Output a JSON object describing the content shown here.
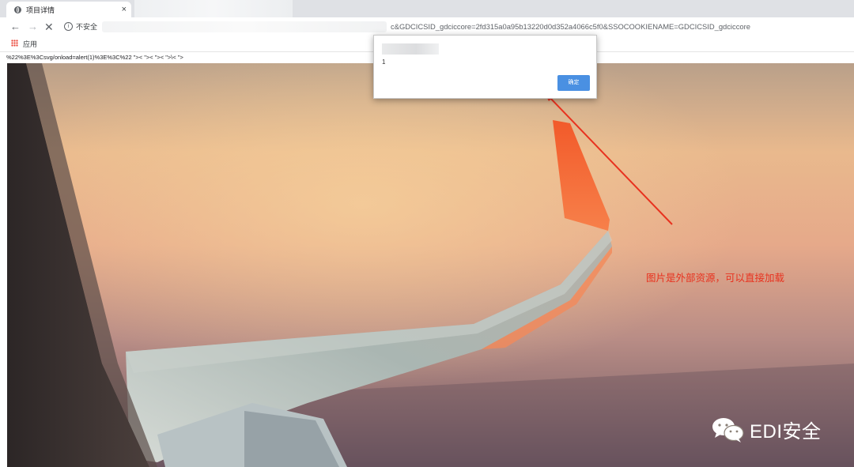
{
  "browser": {
    "tab_title": "项目详情",
    "tab_close": "×",
    "security_label": "不安全",
    "url_visible_text": "c&GDCICSID_gdciccore=2fd315a0a95b13220d0d352a4066c5f0&SSOCOOKIENAME=GDCICSID_gdciccore",
    "bookmark_apps_label": "应用",
    "nav_back": "←",
    "nav_forward": "→",
    "nav_stop": "✕",
    "info_glyph": "i"
  },
  "page": {
    "payload_text": "%22%3E%3Csvg/onload=alert(1)%3E%3C%22 \">< \">< \">< \">\\< \">"
  },
  "alert_dialog": {
    "message": "1",
    "ok_label": "确定"
  },
  "annotation": {
    "text": "图片是外部资源，可以直接加载",
    "color": "#e8321f"
  },
  "watermark": {
    "text": "EDI安全",
    "icon": "wechat-icon"
  },
  "colors": {
    "tabstrip": "#dfe1e5",
    "ok_button": "#4a90e2",
    "sky_top": "#b9a08a",
    "sky_mid": "#e9b98d",
    "wing_tip": "#f25a2a"
  },
  "icons": [
    "globe-icon",
    "close-icon",
    "back-arrow-icon",
    "forward-arrow-icon",
    "stop-icon",
    "info-icon",
    "apps-grid-icon",
    "wechat-icon",
    "red-arrow-icon"
  ]
}
